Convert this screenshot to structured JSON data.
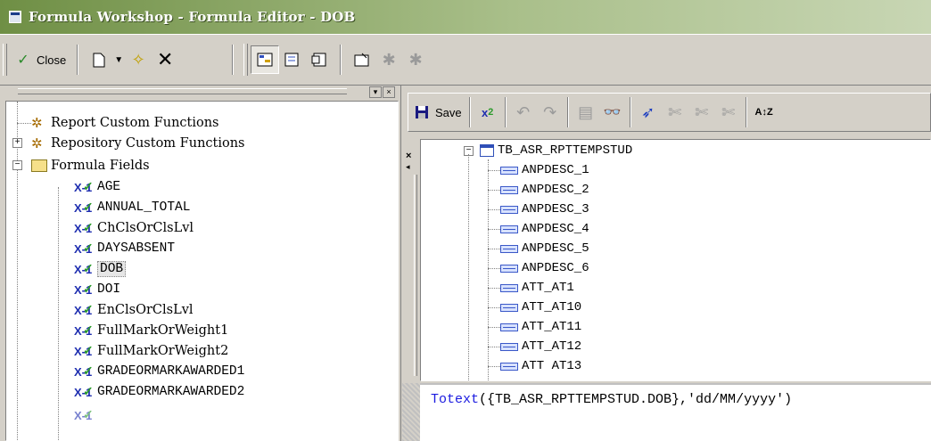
{
  "window": {
    "title": "Formula Workshop - Formula Editor - DOB"
  },
  "toolbar_main": {
    "close_label": "Close",
    "icons": [
      "close-check-icon",
      "new-document-icon",
      "dropdown-arrow-icon",
      "new-wand-icon",
      "delete-x-icon",
      "toggle-tree-icon",
      "toggle-fields-icon",
      "toggle-functions-icon",
      "properties-icon",
      "gear-disabled-icon",
      "gear2-disabled-icon"
    ]
  },
  "tree": {
    "items": [
      {
        "label": "Report Custom Functions",
        "type": "functions"
      },
      {
        "label": "Repository Custom Functions",
        "type": "functions"
      },
      {
        "label": "Formula Fields",
        "type": "folder"
      },
      {
        "label": "AGE",
        "type": "formula"
      },
      {
        "label": "ANNUAL_TOTAL",
        "type": "formula"
      },
      {
        "label": "ChClsOrClsLvl",
        "type": "formula"
      },
      {
        "label": "DAYSABSENT",
        "type": "formula"
      },
      {
        "label": "DOB",
        "type": "formula",
        "selected": true
      },
      {
        "label": "DOI",
        "type": "formula"
      },
      {
        "label": "EnClsOrClsLvl",
        "type": "formula"
      },
      {
        "label": "FullMarkOrWeight1",
        "type": "formula"
      },
      {
        "label": "FullMarkOrWeight2",
        "type": "formula"
      },
      {
        "label": "GRADEORMARKAWARDED1",
        "type": "formula"
      },
      {
        "label": "GRADEORMARKAWARDED2",
        "type": "formula"
      }
    ]
  },
  "editor_toolbar": {
    "save_label": "Save"
  },
  "fields": {
    "table": "TB_ASR_RPTTEMPSTUD",
    "items": [
      "ANPDESC_1",
      "ANPDESC_2",
      "ANPDESC_3",
      "ANPDESC_4",
      "ANPDESC_5",
      "ANPDESC_6",
      "ATT_AT1",
      "ATT_AT10",
      "ATT_AT11",
      "ATT_AT12",
      "ATT AT13"
    ]
  },
  "formula": {
    "function": "Totext",
    "args": "({TB_ASR_RPTTEMPSTUD.DOB},'dd/MM/yyyy')"
  }
}
